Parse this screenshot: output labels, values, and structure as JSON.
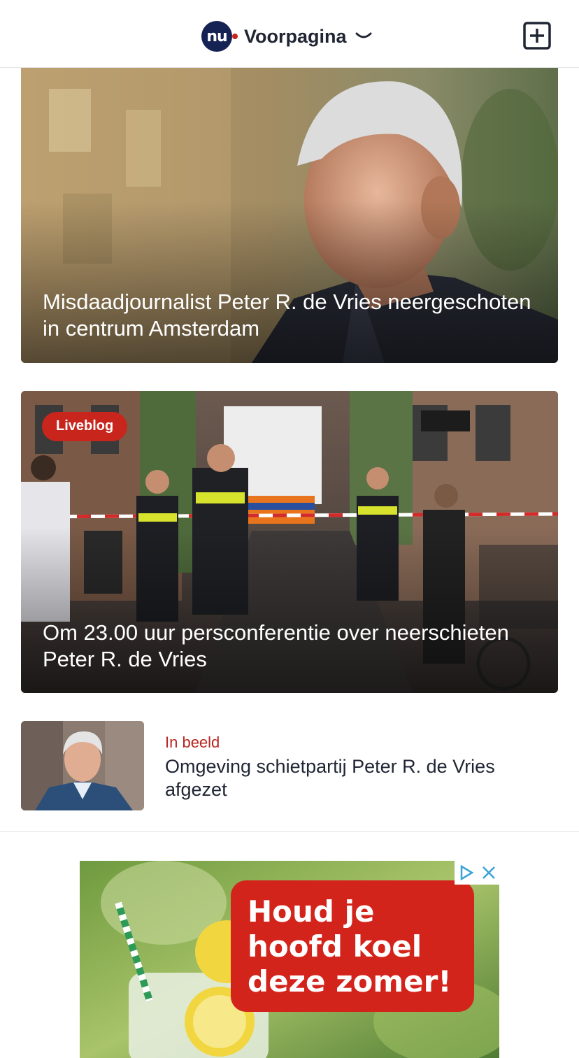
{
  "header": {
    "logo_text": "nu",
    "section_title": "Voorpagina"
  },
  "articles": [
    {
      "title": "Misdaadjournalist Peter R. de Vries neergeschoten in centrum Amsterdam"
    },
    {
      "badge": "Liveblog",
      "title": "Om 23.00 uur persconferentie over neerschieten Peter R. de Vries"
    }
  ],
  "list": [
    {
      "kicker": "In beeld",
      "title": "Omgeving schietpartij Peter R. de Vries afgezet"
    }
  ],
  "ad": {
    "lines": [
      "Houd je",
      "hoofd koel",
      "deze zomer!"
    ]
  },
  "colors": {
    "brand_navy": "#152254",
    "accent_red": "#c8251d",
    "text_dark": "#1f2533"
  }
}
